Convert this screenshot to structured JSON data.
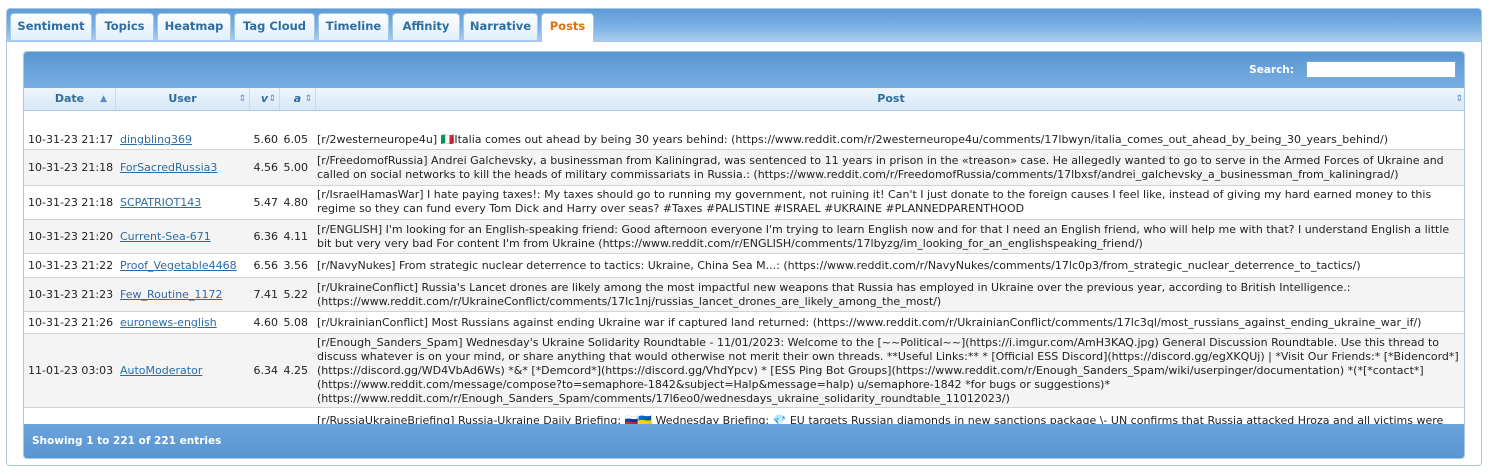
{
  "tabs": [
    {
      "label": "Sentiment"
    },
    {
      "label": "Topics"
    },
    {
      "label": "Heatmap"
    },
    {
      "label": "Tag Cloud"
    },
    {
      "label": "Timeline"
    },
    {
      "label": "Affinity"
    },
    {
      "label": "Narrative"
    },
    {
      "label": "Posts"
    }
  ],
  "active_tab": "Posts",
  "search": {
    "label": "Search:",
    "value": "",
    "placeholder": ""
  },
  "columns": {
    "date": "Date",
    "user": "User",
    "v": "v",
    "a": "a",
    "post": "Post"
  },
  "rows": [
    {
      "date": "10-31-23 21:17",
      "user": "dingbling369",
      "v": "5.60",
      "a": "6.05",
      "post": "[r/2westerneurope4u] 🇮🇹Italia comes out ahead by being 30 years behind: (https://www.reddit.com/r/2westerneurope4u/comments/17lbwyn/italia_comes_out_ahead_by_being_30_years_behind/)"
    },
    {
      "date": "10-31-23 21:18",
      "user": "ForSacredRussia3",
      "v": "4.56",
      "a": "5.00",
      "post": "[r/FreedomofRussia] Andrei Galchevsky, a businessman from Kaliningrad, was sentenced to 11 years in prison in the «treason» case. He allegedly wanted to go to serve in the Armed Forces of Ukraine and called on social networks to kill the heads of military commissariats in Russia.: (https://www.reddit.com/r/FreedomofRussia/comments/17lbxsf/andrei_galchevsky_a_businessman_from_kaliningrad/)"
    },
    {
      "date": "10-31-23 21:18",
      "user": "SCPATRIOT143",
      "v": "5.47",
      "a": "4.80",
      "post": "[r/IsraelHamasWar] I hate paying taxes!: My taxes should go to running my government, not ruining it! Can't I just donate to the foreign causes I feel like, instead of giving my hard earned money to this regime so they can fund every Tom Dick and Harry over seas? #Taxes #PALISTINE #ISRAEL #UKRAINE #PLANNEDPARENTHOOD (https://www.reddit.com/r/IsraelHamasWar/comments/17lbxpg/i_hate_paying_taxes/)"
    },
    {
      "date": "10-31-23 21:20",
      "user": "Current-Sea-671",
      "v": "6.36",
      "a": "4.11",
      "post": "[r/ENGLISH] I'm looking for an English-speaking friend: Good afternoon everyone I'm trying to learn English now and for that I need an English friend, who will help me with that? I understand English a little bit but very very bad For content I'm from Ukraine (https://www.reddit.com/r/ENGLISH/comments/17lbyzg/im_looking_for_an_englishspeaking_friend/)"
    },
    {
      "date": "10-31-23 21:22",
      "user": "Proof_Vegetable4468",
      "v": "6.56",
      "a": "3.56",
      "post": "[r/NavyNukes] From strategic nuclear deterrence to tactics: Ukraine, China Sea M...: (https://www.reddit.com/r/NavyNukes/comments/17lc0p3/from_strategic_nuclear_deterrence_to_tactics/)"
    },
    {
      "date": "10-31-23 21:23",
      "user": "Few_Routine_1172",
      "v": "7.41",
      "a": "5.22",
      "post": "[r/UkraineConflict] Russia's Lancet drones are likely among the most impactful new weapons that Russia has employed in Ukraine over the previous year, according to British Intelligence.: (https://www.reddit.com/r/UkraineConflict/comments/17lc1nj/russias_lancet_drones_are_likely_among_the_most/)"
    },
    {
      "date": "10-31-23 21:26",
      "user": "euronews-english",
      "v": "4.60",
      "a": "5.08",
      "post": "[r/UkrainianConflict] Most Russians against ending Ukraine war if captured land returned: (https://www.reddit.com/r/UkrainianConflict/comments/17lc3ql/most_russians_against_ending_ukraine_war_if/)"
    },
    {
      "date": "11-01-23 03:03",
      "user": "AutoModerator",
      "v": "6.34",
      "a": "4.25",
      "post": "[r/Enough_Sanders_Spam] Wednesday's Ukraine Solidarity Roundtable - 11/01/2023: Welcome to the [~~Political~~](https://i.imgur.com/AmH3KAQ.jpg) General Discussion Roundtable. Use this thread to discuss whatever is on your mind, or share anything that would otherwise not merit their own threads. **Useful Links:** * [Official ESS Discord](https://discord.gg/egXKQUj) | *Visit Our Friends:* [*Bidencord*](https://discord.gg/WD4VbAd6Ws) *&* [*Demcord*](https://discord.gg/VhdYpcv) * [ESS Ping Bot Groups](https://www.reddit.com/r/Enough_Sanders_Spam/wiki/userpinger/documentation) *(*[*contact*](https://www.reddit.com/message/compose?to=semaphore-1842&subject=Halp&message=halp) u/semaphore-1842 *for bugs or suggestions)* (https://www.reddit.com/r/Enough_Sanders_Spam/comments/17l6eo0/wednesdays_ukraine_solidarity_roundtable_11012023/)"
    },
    {
      "date": "",
      "user": "",
      "v": "",
      "a": "",
      "post": "[r/RussiaUkraineBriefing] Russia-Ukraine Daily Briefing: 🇷🇺🇺🇦 Wednesday Briefing: 💎 EU targets Russian diamonds in new sanctions package \\- UN confirms that Russia attacked Hroza and all victims were civilians"
    }
  ],
  "footer": {
    "info": "Showing 1 to 221 of 221 entries"
  },
  "colors": {
    "accent": "#e17009",
    "header": "#5a96d2",
    "link": "#2a6ca8",
    "keyword": "#2e6e9e",
    "ukraine": "#c0392b"
  }
}
